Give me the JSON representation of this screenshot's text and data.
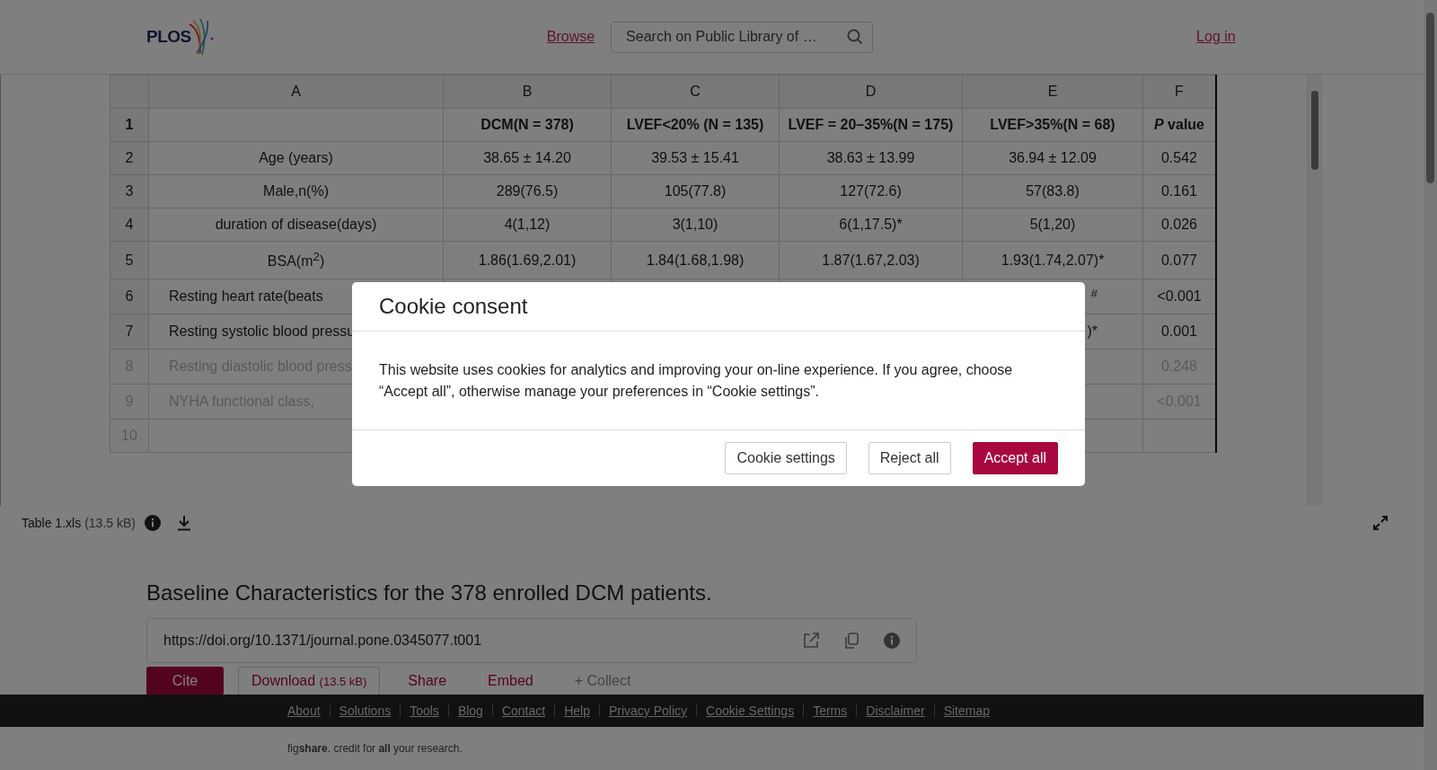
{
  "header": {
    "logo": "PLOS",
    "nav_link": "Browse",
    "search": {
      "placeholder": "Search on Public Library of …"
    },
    "login": "Log in"
  },
  "sheet": {
    "columns": [
      "A",
      "B",
      "C",
      "D",
      "E",
      "F"
    ],
    "rows": [
      {
        "number": "1",
        "kind": "heading",
        "faded": false,
        "cells": [
          null,
          "DCM(N = 378)",
          "LVEF<20% (N = 135)",
          "LVEF = 20–35%(N = 175)",
          "LVEF>35%(N = 68)",
          "*P* value"
        ]
      },
      {
        "number": "2",
        "kind": "data",
        "faded": false,
        "cells": [
          "Age (years)",
          "38.65 ± 14.20",
          "39.53 ± 15.41",
          "38.63 ± 13.99",
          "36.94 ± 12.09",
          "0.542"
        ]
      },
      {
        "number": "3",
        "kind": "data",
        "faded": false,
        "cells": [
          "Male,n(%)",
          "289(76.5)",
          "105(77.8)",
          "127(72.6)",
          "57(83.8)",
          "0.161"
        ]
      },
      {
        "number": "4",
        "kind": "data",
        "faded": false,
        "cells": [
          "duration of disease(days)",
          "4(1,12)",
          "3(1,10)",
          "6(1,17.5)*",
          "5(1,20)",
          "0.026"
        ]
      },
      {
        "number": "5",
        "kind": "tall",
        "faded": false,
        "cells": [
          "BSA(m$^{2}$)",
          "1.86(1.69,2.01)",
          "1.84(1.68,1.98)",
          "1.87(1.67,2.03)",
          "1.93(1.74,2.07)*",
          "0.077"
        ]
      },
      {
        "number": "6",
        "kind": "covered",
        "faded": false,
        "cells": [
          "Resting heart rate(beats",
          null,
          null,
          null,
          "$^{#}$",
          "<0.001"
        ]
      },
      {
        "number": "7",
        "kind": "covered",
        "faded": false,
        "cells": [
          "Resting systolic blood pressu",
          null,
          null,
          null,
          ")*",
          "0.001"
        ]
      },
      {
        "number": "8",
        "kind": "covered",
        "faded": true,
        "cells": [
          "Resting diastolic blood press",
          null,
          null,
          null,
          null,
          "0.248"
        ]
      },
      {
        "number": "9",
        "kind": "covered",
        "faded": true,
        "cells": [
          "NYHA functional class,",
          null,
          null,
          null,
          null,
          "<0.001"
        ]
      },
      {
        "number": "10",
        "kind": "data",
        "faded": true,
        "cells": [
          null,
          null,
          null,
          null,
          null,
          null
        ]
      }
    ]
  },
  "file": {
    "name": "Table 1.xls",
    "size": "(13.5 kB)"
  },
  "caption": {
    "title": "Baseline Characteristics for the 378 enrolled DCM patients.",
    "doi": "https://doi.org/10.1371/journal.pone.0345077.t001",
    "actions": [
      {
        "label": "Cite",
        "kind": "primary"
      },
      {
        "label": "Download",
        "extra": "(13.5 kB)",
        "kind": "outline"
      },
      {
        "label": "Share",
        "kind": "link"
      },
      {
        "label": "Embed",
        "kind": "link"
      },
      {
        "label": "+ Collect",
        "kind": "muted"
      }
    ]
  },
  "footer": {
    "links": [
      "About",
      "Solutions",
      "Tools",
      "Blog",
      "Contact",
      "Help",
      "Privacy Policy",
      "Cookie Settings",
      "Terms",
      "Disclaimer",
      "Sitemap"
    ],
    "tagline": "fig**share**. credit for **all** your research."
  },
  "cookie": {
    "title": "Cookie consent",
    "text": "This website uses cookies for analytics and improving your on-line experience. If you agree, choose “Accept all”, otherwise manage your preferences in “Cookie settings”.",
    "buttons": [
      {
        "label": "Cookie settings",
        "kind": "secondary"
      },
      {
        "label": "Reject all",
        "kind": "secondary"
      },
      {
        "label": "Accept all",
        "kind": "primary"
      }
    ]
  }
}
